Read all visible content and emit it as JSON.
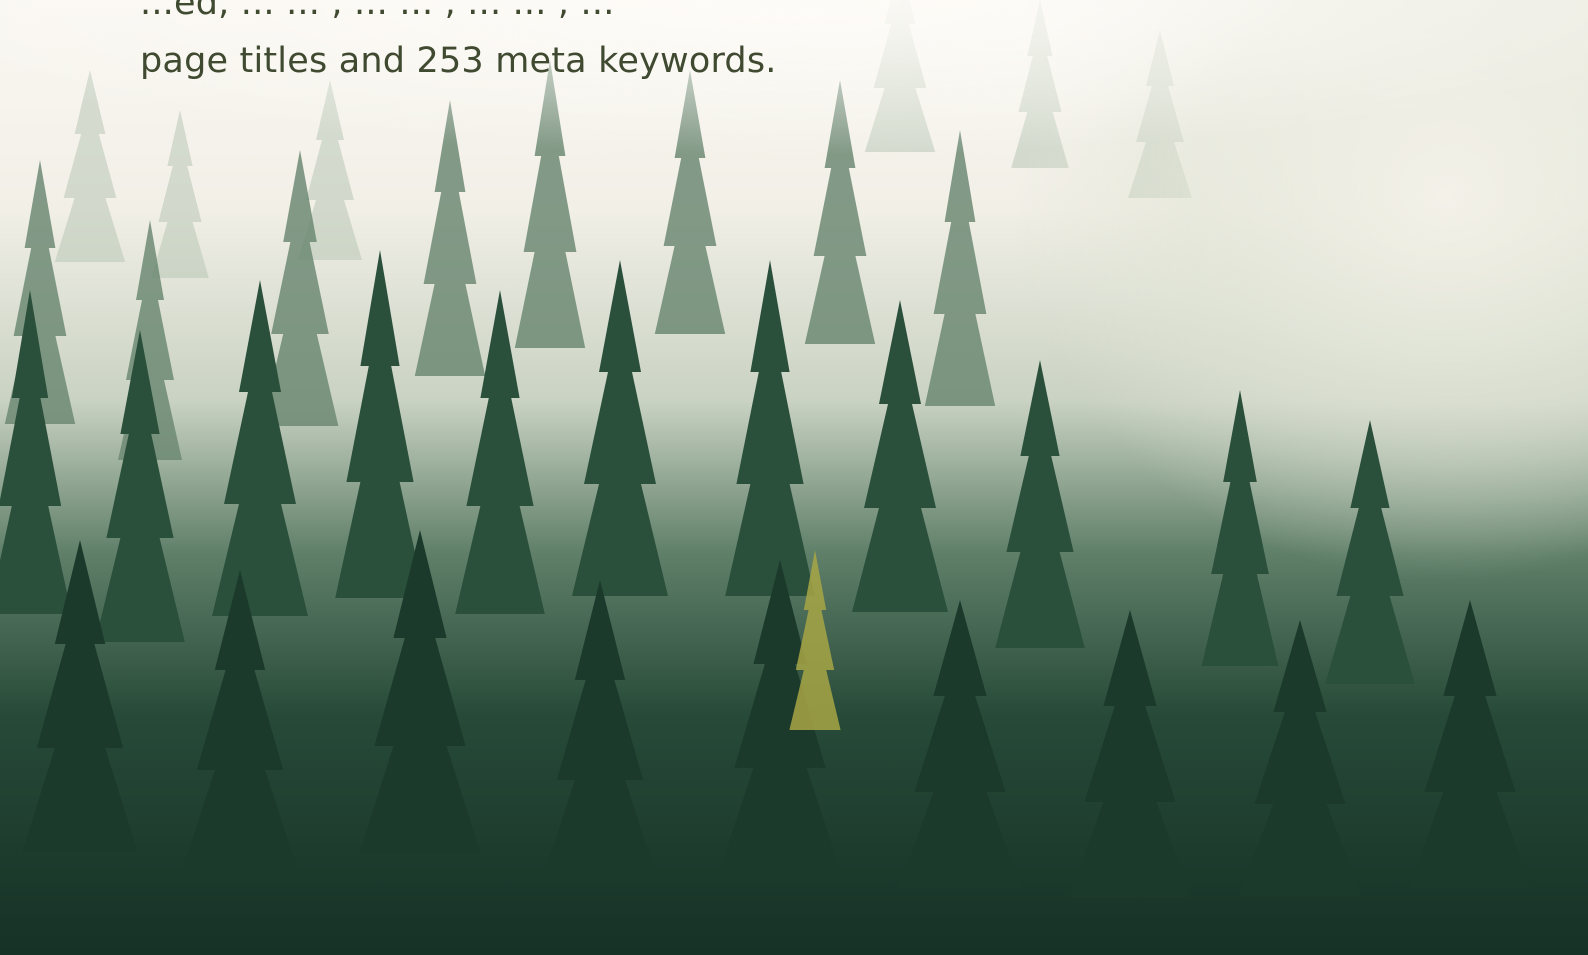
{
  "hero": {
    "image_description": "misty-pine-forest-photo"
  },
  "intro": {
    "line1": "...ed, ... ... , ... ... , ... ... , ...",
    "line2": "page titles and 253 meta keywords."
  },
  "colors": {
    "text": "#3f4a31",
    "fog": "#f5f1ec",
    "forest_dark": "#1d3a2c",
    "forest_mid": "#2f5a44",
    "forest_light": "#6f8d77"
  }
}
